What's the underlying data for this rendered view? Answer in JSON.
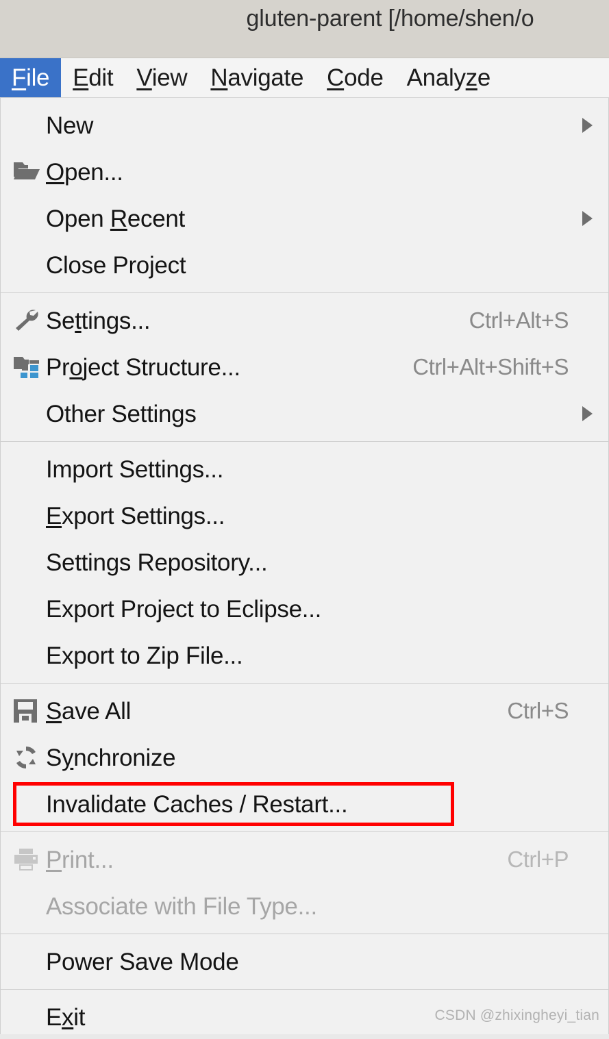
{
  "window": {
    "title": "gluten-parent [/home/shen/o"
  },
  "menubar": {
    "items": [
      {
        "label": "File",
        "mnemonic": "F",
        "active": true
      },
      {
        "label": "Edit",
        "mnemonic": "E",
        "active": false
      },
      {
        "label": "View",
        "mnemonic": "V",
        "active": false
      },
      {
        "label": "Navigate",
        "mnemonic": "N",
        "active": false
      },
      {
        "label": "Code",
        "mnemonic": "C",
        "active": false
      },
      {
        "label": "Analyze",
        "mnemonic": "z",
        "active": false
      }
    ],
    "active_color": "#3a72c8"
  },
  "file_menu": {
    "groups": [
      {
        "items": [
          {
            "label": "New",
            "icon": "",
            "shortcut": "",
            "submenu": true,
            "disabled": false
          },
          {
            "label": "Open...",
            "icon": "folder-open-icon",
            "shortcut": "",
            "submenu": false,
            "disabled": false
          },
          {
            "label": "Open Recent",
            "icon": "",
            "shortcut": "",
            "submenu": true,
            "disabled": false
          },
          {
            "label": "Close Project",
            "icon": "",
            "shortcut": "",
            "submenu": false,
            "disabled": false
          }
        ]
      },
      {
        "items": [
          {
            "label": "Settings...",
            "icon": "wrench-icon",
            "shortcut": "Ctrl+Alt+S",
            "submenu": false,
            "disabled": false
          },
          {
            "label": "Project Structure...",
            "icon": "project-structure-icon",
            "shortcut": "Ctrl+Alt+Shift+S",
            "submenu": false,
            "disabled": false
          },
          {
            "label": "Other Settings",
            "icon": "",
            "shortcut": "",
            "submenu": true,
            "disabled": false
          }
        ]
      },
      {
        "items": [
          {
            "label": "Import Settings...",
            "icon": "",
            "shortcut": "",
            "submenu": false,
            "disabled": false
          },
          {
            "label": "Export Settings...",
            "icon": "",
            "shortcut": "",
            "submenu": false,
            "disabled": false
          },
          {
            "label": "Settings Repository...",
            "icon": "",
            "shortcut": "",
            "submenu": false,
            "disabled": false
          },
          {
            "label": "Export Project to Eclipse...",
            "icon": "",
            "shortcut": "",
            "submenu": false,
            "disabled": false
          },
          {
            "label": "Export to Zip File...",
            "icon": "",
            "shortcut": "",
            "submenu": false,
            "disabled": false
          }
        ]
      },
      {
        "items": [
          {
            "label": "Save All",
            "icon": "save-icon",
            "shortcut": "Ctrl+S",
            "submenu": false,
            "disabled": false
          },
          {
            "label": "Synchronize",
            "icon": "synchronize-icon",
            "shortcut": "",
            "submenu": false,
            "disabled": false
          },
          {
            "label": "Invalidate Caches / Restart...",
            "icon": "",
            "shortcut": "",
            "submenu": false,
            "disabled": false,
            "highlighted": true
          }
        ]
      },
      {
        "items": [
          {
            "label": "Print...",
            "icon": "printer-icon",
            "shortcut": "Ctrl+P",
            "submenu": false,
            "disabled": true
          },
          {
            "label": "Associate with File Type...",
            "icon": "",
            "shortcut": "",
            "submenu": false,
            "disabled": true
          }
        ]
      },
      {
        "items": [
          {
            "label": "Power Save Mode",
            "icon": "",
            "shortcut": "",
            "submenu": false,
            "disabled": false
          }
        ]
      },
      {
        "items": [
          {
            "label": "Exit",
            "icon": "",
            "shortcut": "",
            "submenu": false,
            "disabled": false
          }
        ]
      }
    ]
  },
  "annotation": {
    "color": "#ff0000",
    "target_label": "Invalidate Caches / Restart..."
  },
  "watermark": {
    "text": "CSDN @zhixingheyi_tian"
  }
}
